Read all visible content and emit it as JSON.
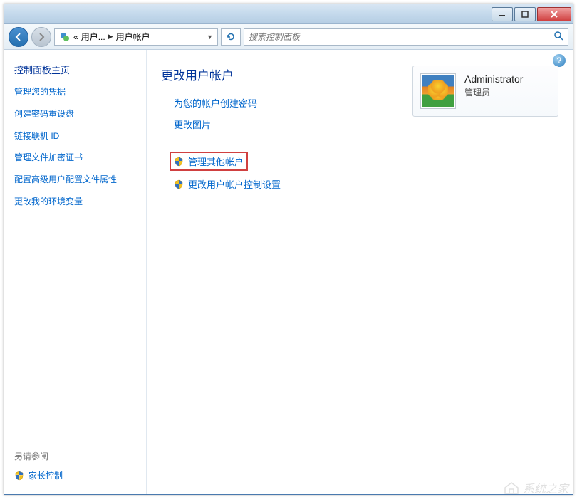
{
  "titlebar": {
    "title": ""
  },
  "breadcrumb": {
    "prefix": "«",
    "seg1": "用户...",
    "sep": "▶",
    "seg2": "用户帐户"
  },
  "search": {
    "placeholder": "搜索控制面板"
  },
  "sidebar": {
    "title": "控制面板主页",
    "links": [
      "管理您的凭据",
      "创建密码重设盘",
      "链接联机 ID",
      "管理文件加密证书",
      "配置高级用户配置文件属性",
      "更改我的环境变量"
    ],
    "footer_title": "另请参阅",
    "footer_link": "家长控制"
  },
  "main": {
    "title": "更改用户帐户",
    "links": {
      "create_password": "为您的帐户创建密码",
      "change_picture": "更改图片",
      "manage_other": "管理其他帐户",
      "change_uac": "更改用户帐户控制设置"
    }
  },
  "account": {
    "name": "Administrator",
    "role": "管理员"
  },
  "watermark": "系统之家",
  "help": "?"
}
